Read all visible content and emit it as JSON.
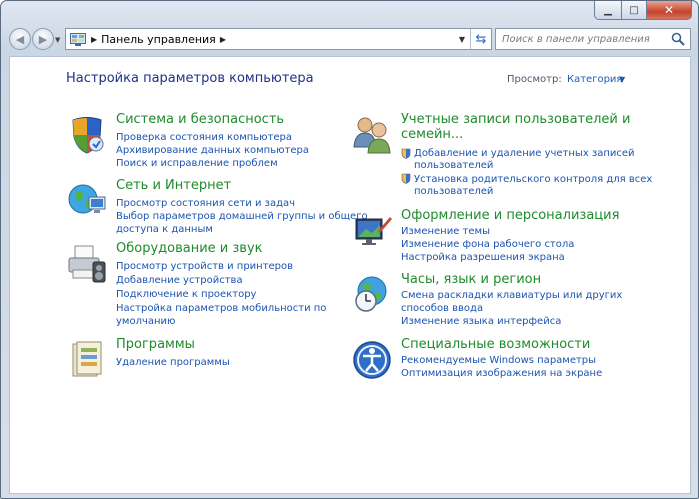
{
  "window": {
    "buttons": {
      "minimize": "▁",
      "maximize": "□",
      "close": "✕"
    }
  },
  "toolbar": {
    "breadcrumb": "Панель управления",
    "search_placeholder": "Поиск в панели управления"
  },
  "main": {
    "title": "Настройка параметров компьютера",
    "view_by_label": "Просмотр:",
    "view_by_value": "Категория"
  },
  "left_categories": [
    {
      "title": "Система и безопасность",
      "icon": "shield-icon",
      "links": [
        "Проверка состояния компьютера",
        "Архивирование данных компьютера",
        "Поиск и исправление проблем"
      ]
    },
    {
      "title": "Сеть и Интернет",
      "icon": "network-globe-icon",
      "links": [
        "Просмотр состояния сети и задач",
        "Выбор параметров домашней группы и общего",
        "доступа к данным"
      ]
    },
    {
      "title": "Оборудование и звук",
      "icon": "printer-icon",
      "links": [
        "Просмотр устройств и принтеров",
        "Добавление устройства",
        "Подключение к проектору",
        "Настройка параметров мобильности по",
        "умолчанию"
      ]
    },
    {
      "title": "Программы",
      "icon": "programs-icon",
      "links": [
        "Удаление программы"
      ]
    }
  ],
  "right_categories": [
    {
      "title": "Учетные записи пользователей и",
      "title2": "семейн...",
      "icon": "users-icon",
      "links": [
        "Добавление и удаление учетных записей",
        "пользователей",
        "Установка родительского контроля для всех",
        "пользователей"
      ]
    },
    {
      "title": "Оформление и персонализация",
      "icon": "display-icon",
      "links": [
        "Изменение темы",
        "Изменение фона рабочего стола",
        "Настройка разрешения экрана"
      ]
    },
    {
      "title": "Часы, язык и регион",
      "icon": "clock-globe-icon",
      "links": [
        "Смена раскладки клавиатуры или других",
        "способов ввода",
        "Изменение языка интерфейса"
      ]
    },
    {
      "title": "Специальные возможности",
      "icon": "accessibility-icon",
      "links": [
        "Рекомендуемые Windows параметры",
        "Оптимизация изображения на экране"
      ]
    }
  ]
}
